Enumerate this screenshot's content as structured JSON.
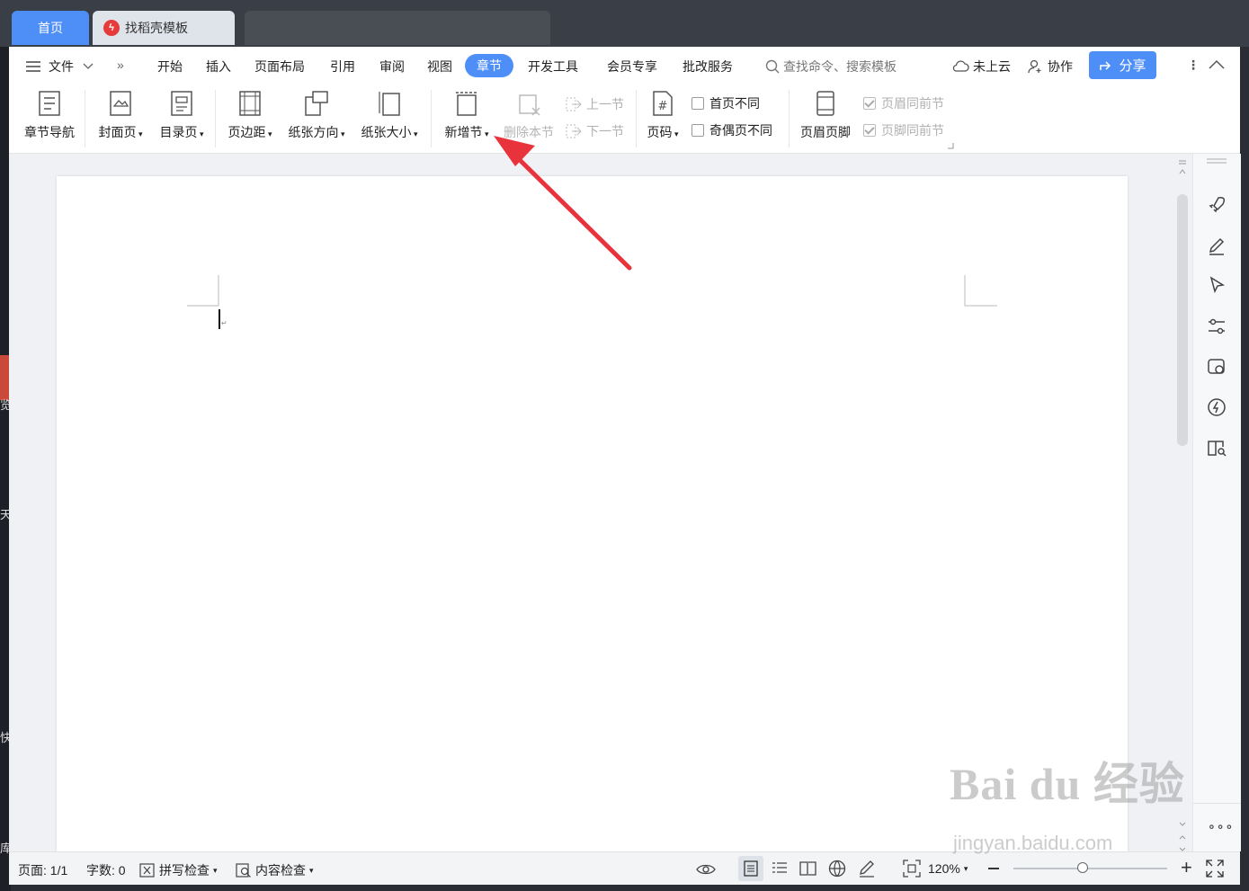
{
  "tabs": {
    "home": "首页",
    "template": "找稻壳模板"
  },
  "menu": {
    "file": "文件",
    "items": [
      "开始",
      "插入",
      "页面布局",
      "引用",
      "审阅",
      "视图"
    ],
    "active": "章节",
    "items_after": [
      "开发工具",
      "会员专享",
      "批改服务"
    ],
    "search_placeholder": "查找命令、搜索模板",
    "cloud": "未上云",
    "collab": "协作",
    "share": "分享"
  },
  "ribbon": {
    "chapter_nav": "章节导航",
    "cover": "封面页",
    "toc": "目录页",
    "margin": "页边距",
    "orientation": "纸张方向",
    "size": "纸张大小",
    "new_section": "新增节",
    "delete_section": "删除本节",
    "prev_section": "上一节",
    "next_section": "下一节",
    "page_number": "页码",
    "first_page_diff": "首页不同",
    "odd_even_diff": "奇偶页不同",
    "header_footer": "页眉页脚",
    "header_same_prev": "页眉同前节",
    "footer_same_prev": "页脚同前节"
  },
  "status": {
    "page": "页面: 1/1",
    "words": "字数: 0",
    "spell": "拼写检查",
    "content_check": "内容检查",
    "zoom": "120%",
    "zoom_level": 0.45
  },
  "watermark": {
    "logo": "Bai du 经验",
    "url": "jingyan.baidu.com"
  },
  "desktop_edge": [
    "览",
    "天",
    "快",
    "库"
  ],
  "colors": {
    "accent": "#4e8ef7",
    "arrow": "#e8323c"
  }
}
